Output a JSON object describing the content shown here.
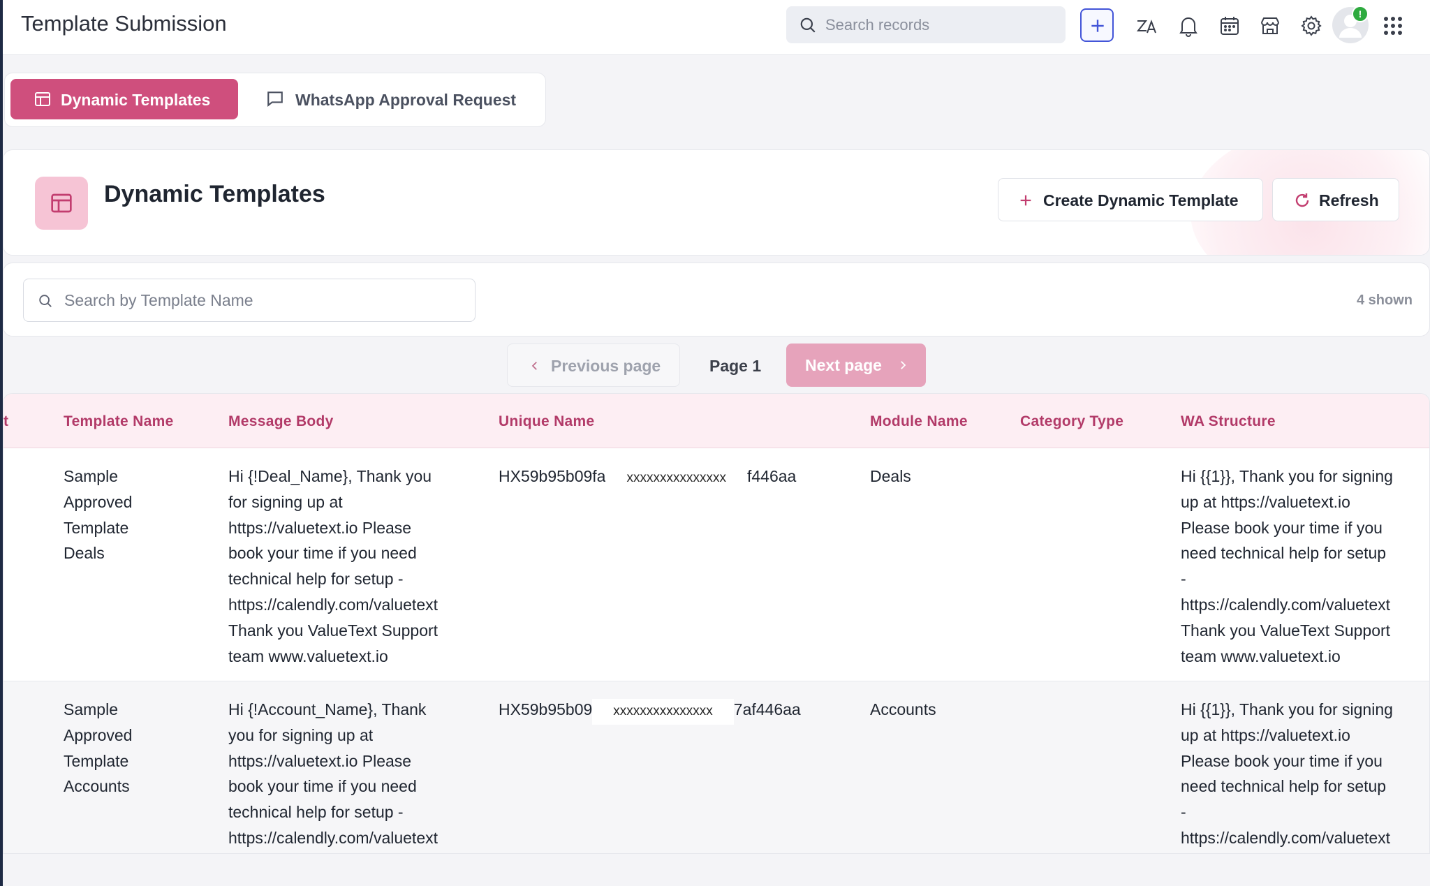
{
  "app": {
    "title": "Template Submission",
    "search_placeholder": "Search records",
    "notification_badge": "!"
  },
  "tabs": [
    {
      "label": "Dynamic Templates",
      "active": true
    },
    {
      "label": "WhatsApp Approval Request",
      "active": false
    }
  ],
  "header": {
    "title": "Dynamic Templates",
    "create_label": "Create Dynamic Template",
    "refresh_label": "Refresh"
  },
  "filter": {
    "search_placeholder": "Search by Template Name",
    "shown_count": "4 shown"
  },
  "pagination": {
    "prev_label": "Previous page",
    "current_label": "Page 1",
    "next_label": "Next page"
  },
  "table": {
    "clipped_first_header": "t",
    "columns": [
      "Template Name",
      "Message Body",
      "Unique Name",
      "Module Name",
      "Category Type",
      "WA Structure"
    ],
    "rows": [
      {
        "template_name": "Sample\nApproved\nTemplate\nDeals",
        "message_body": "Hi {!Deal_Name}, Thank you\nfor signing up at\nhttps://valuetext.io Please\nbook your time if you need\ntechnical help for setup -\nhttps://calendly.com/valuetext\nThank you ValueText Support\nteam www.valuetext.io",
        "unique_prefix": "HX59b95b09fa",
        "unique_mask": "xxxxxxxxxxxxxxx",
        "unique_suffix": "f446aa",
        "module_name": "Deals",
        "category_type": "",
        "wa_structure": "Hi {{1}}, Thank you for signing\nup at https://valuetext.io\nPlease book your time if you\nneed technical help for setup\n-\nhttps://calendly.com/valuetext\nThank you ValueText Support\nteam www.valuetext.io"
      },
      {
        "template_name": "Sample\nApproved\nTemplate\nAccounts",
        "message_body": "Hi {!Account_Name}, Thank\nyou for signing up at\nhttps://valuetext.io Please\nbook your time if you need\ntechnical help for setup -\nhttps://calendly.com/valuetext",
        "unique_prefix": "HX59b95b09",
        "unique_mask": "xxxxxxxxxxxxxxx",
        "unique_suffix": "7af446aa",
        "module_name": "Accounts",
        "category_type": "",
        "wa_structure": "Hi {{1}}, Thank you for signing\nup at https://valuetext.io\nPlease book your time if you\nneed technical help for setup\n-\nhttps://calendly.com/valuetext"
      }
    ]
  },
  "colors": {
    "accent": "#cf4f7d",
    "accent_light": "#f6c4d5",
    "header_row_bg": "#fdeef3",
    "header_text": "#b23a68",
    "status_online": "#2eaa3f",
    "add_button_border": "#4355d8"
  },
  "icons": {
    "top_search": "search-icon",
    "add": "plus-icon",
    "translate": "translate-icon",
    "bell": "bell-icon",
    "calendar": "calendar-icon",
    "store": "store-icon",
    "settings": "gear-icon",
    "apps": "grid-apps-icon",
    "tab_dynamic": "table-icon",
    "tab_whatsapp": "chat-bubble-icon",
    "header": "table-icon",
    "create": "plus-icon",
    "refresh": "refresh-icon",
    "filter_search": "search-icon",
    "prev": "chevron-left-icon",
    "next": "chevron-right-icon"
  }
}
